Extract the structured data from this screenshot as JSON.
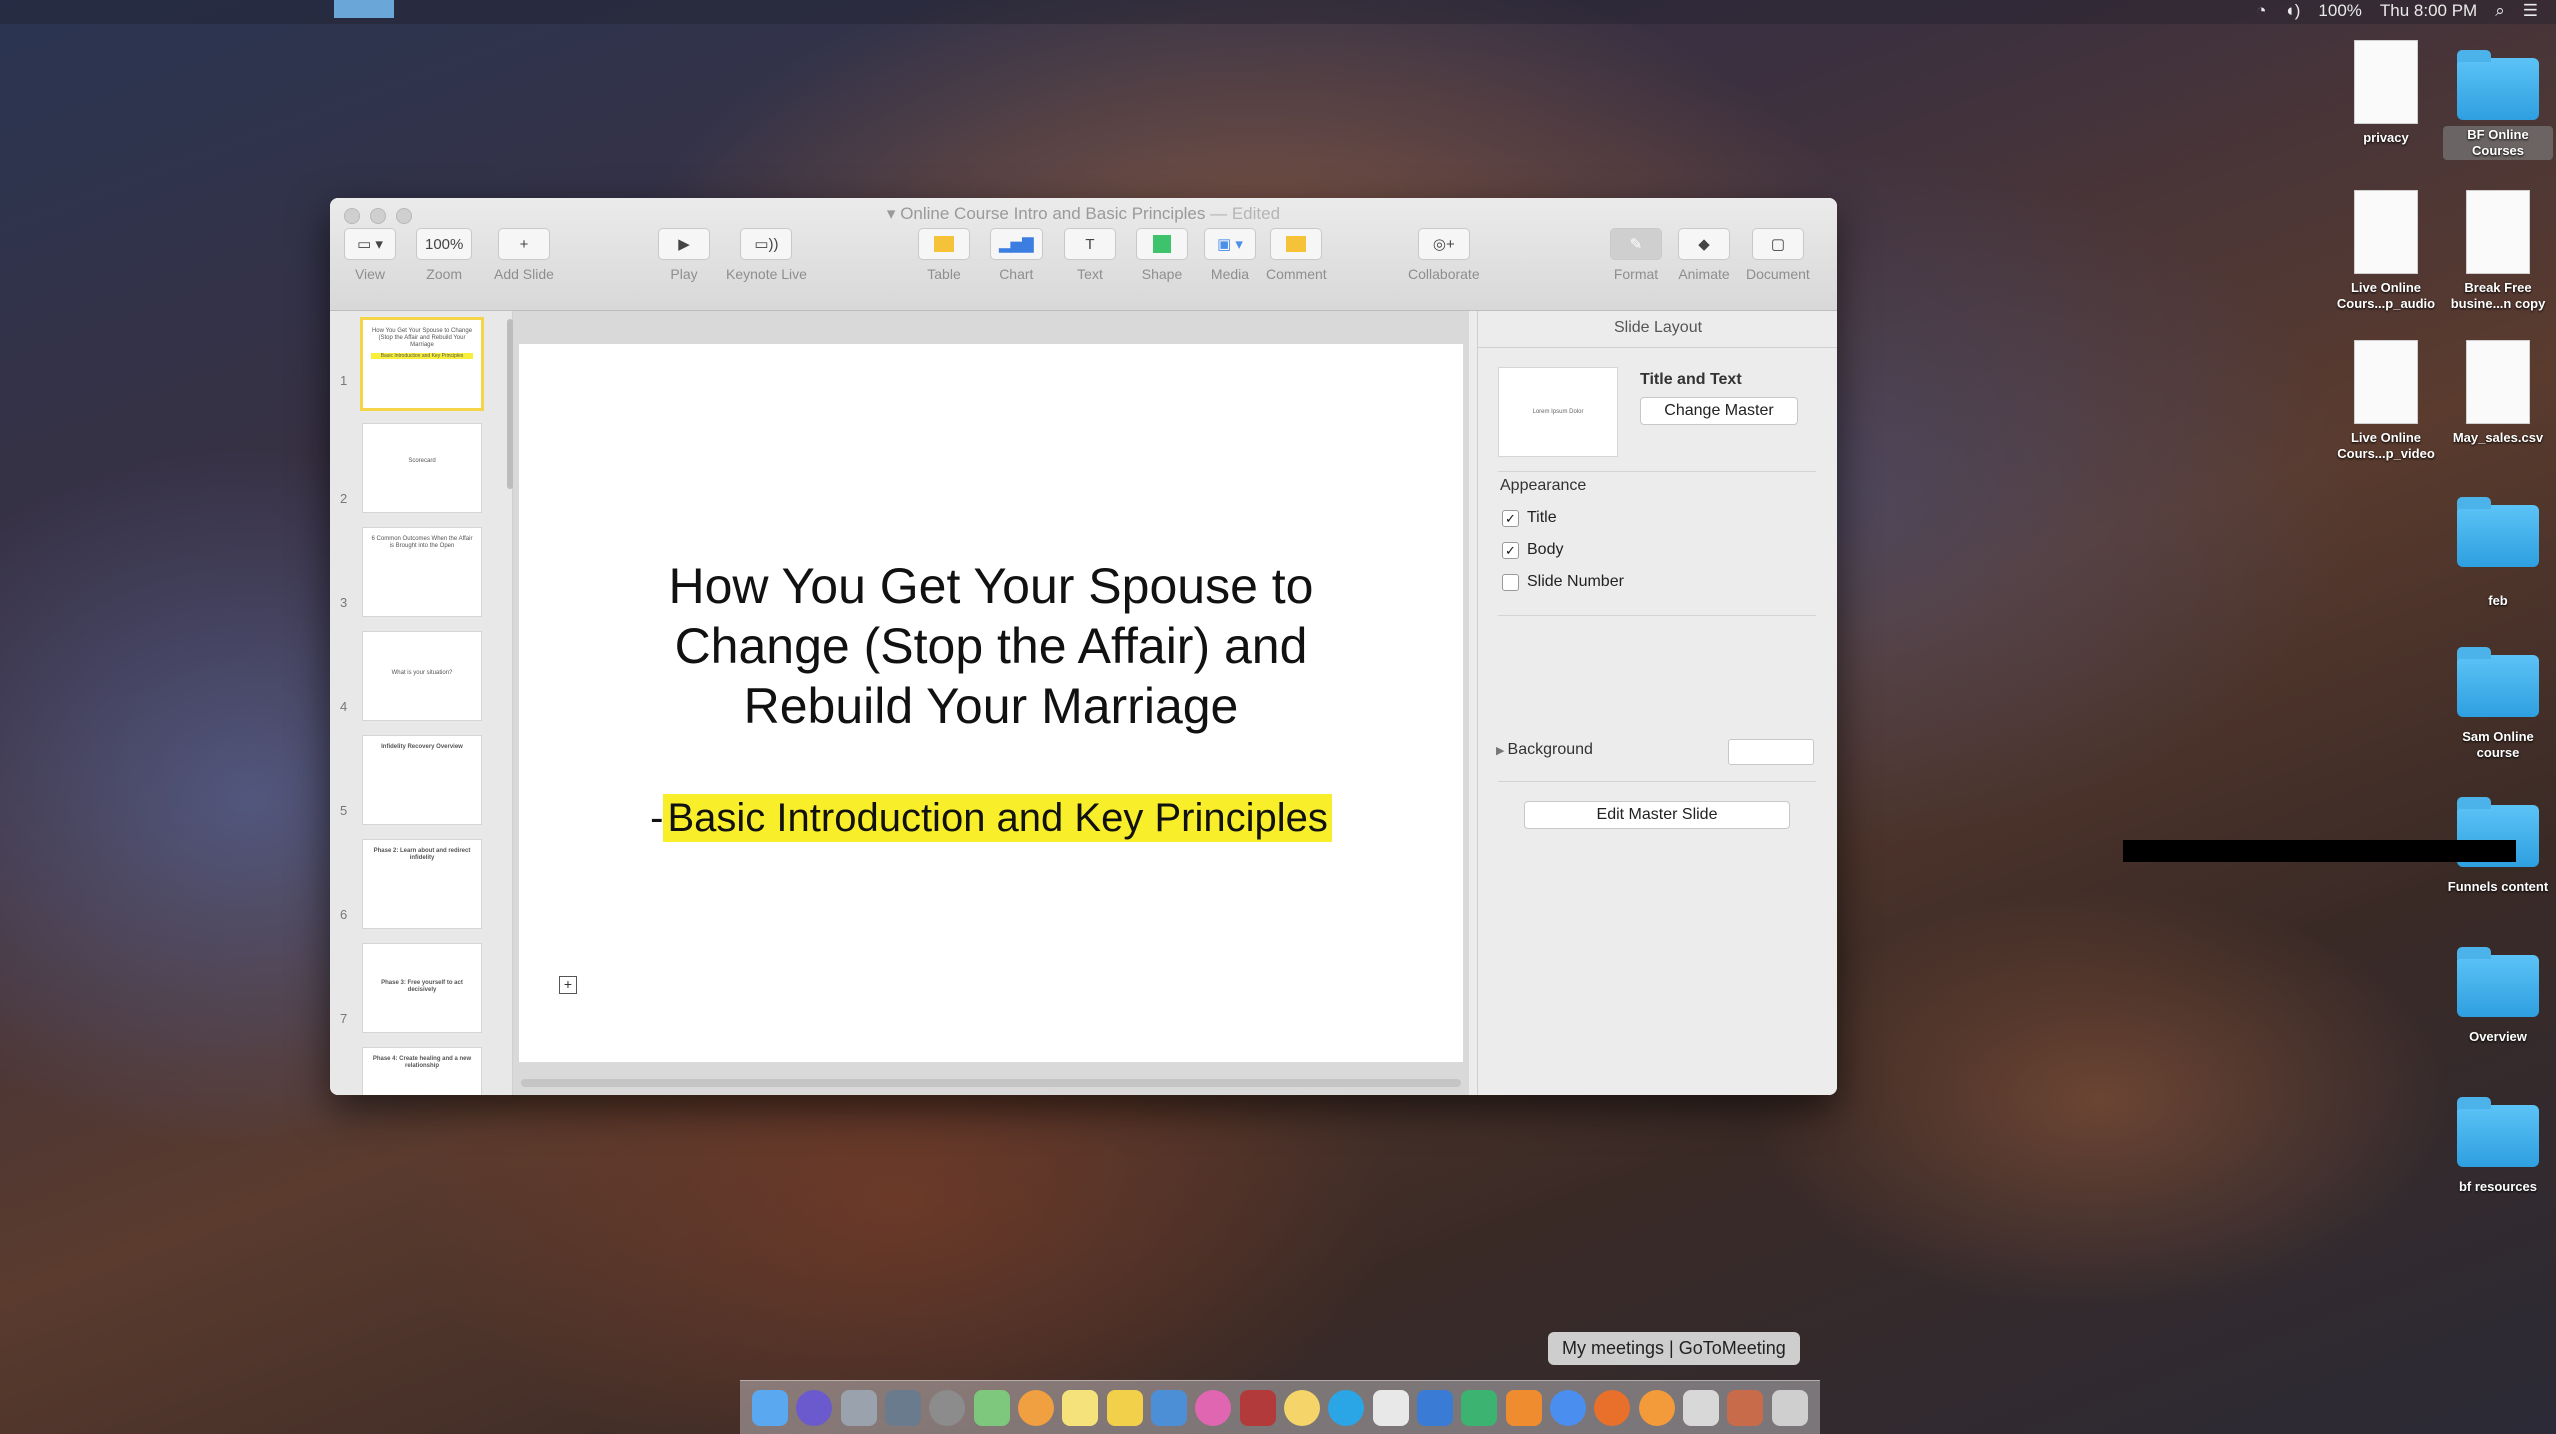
{
  "menubar": {
    "status_items": [
      "100%",
      "Thu 8:00 PM"
    ]
  },
  "window": {
    "title": "Online Course Intro and Basic Principles",
    "edited": "— Edited"
  },
  "toolbar": {
    "view": "View",
    "zoom_value": "100%",
    "zoom": "Zoom",
    "add_slide": "Add Slide",
    "play": "Play",
    "keynote_live": "Keynote Live",
    "table": "Table",
    "chart": "Chart",
    "text": "Text",
    "shape": "Shape",
    "media": "Media",
    "comment": "Comment",
    "collaborate": "Collaborate",
    "format": "Format",
    "animate": "Animate",
    "document": "Document"
  },
  "navigator": {
    "slides": [
      {
        "num": "1",
        "title": "How You Get Your Spouse to Change (Stop the Affair and Rebuild Your Marriage",
        "highlight": "Basic Introduction and Key Principles"
      },
      {
        "num": "2",
        "title": "Scorecard"
      },
      {
        "num": "3",
        "title": "6 Common Outcomes When the Affair is Brought into the Open"
      },
      {
        "num": "4",
        "title": "What is your situation?"
      },
      {
        "num": "5",
        "title": "Infidelity Recovery Overview"
      },
      {
        "num": "6",
        "title": "Phase 2: Learn about and redirect infidelity"
      },
      {
        "num": "7",
        "title": "Phase 3: Free yourself to act decisively"
      },
      {
        "num": "",
        "title": "Phase 4: Create healing and a new relationship"
      }
    ]
  },
  "slide": {
    "title": "How You Get Your Spouse to Change (Stop the Affair) and Rebuild Your Marriage",
    "subtitle_prefix": "-",
    "subtitle": "Basic Introduction and Key Principles"
  },
  "inspector": {
    "header": "Slide Layout",
    "master_preview": "Lorem Ipsum Dolor",
    "master_name": "Title and Text",
    "change_master": "Change Master",
    "appearance": "Appearance",
    "title_label": "Title",
    "body_label": "Body",
    "slide_number_label": "Slide Number",
    "background": "Background",
    "edit_master": "Edit Master Slide"
  },
  "desktop": {
    "icons": [
      {
        "label": "privacy",
        "kind": "file"
      },
      {
        "label": "BF Online Courses",
        "kind": "folder"
      },
      {
        "label": "Live Online Cours...p_audio",
        "kind": "file"
      },
      {
        "label": "Break Free busine...n copy",
        "kind": "file"
      },
      {
        "label": "Live Online Cours...p_video",
        "kind": "file"
      },
      {
        "label": "May_sales.csv",
        "kind": "file"
      },
      {
        "label": "feb",
        "kind": "folder"
      },
      {
        "label": "Sam Online course",
        "kind": "folder"
      },
      {
        "label": "Funnels content",
        "kind": "folder"
      },
      {
        "label": "Overview",
        "kind": "folder"
      },
      {
        "label": "bf resources",
        "kind": "folder"
      }
    ]
  },
  "dock": {
    "tooltip": "My meetings | GoToMeeting"
  }
}
